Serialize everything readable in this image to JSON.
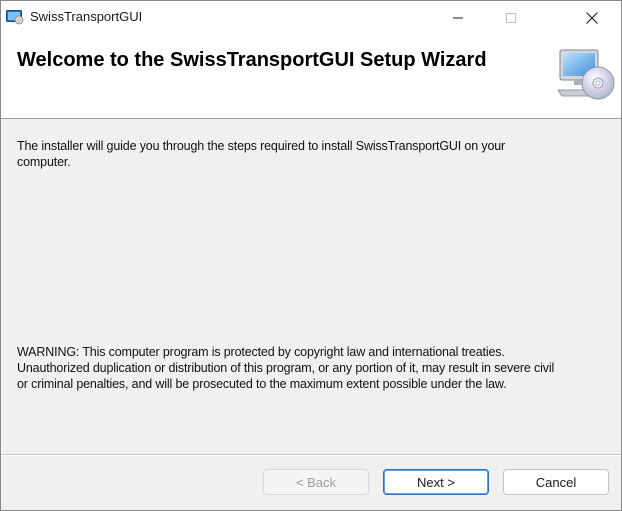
{
  "window": {
    "title": "SwissTransportGUI",
    "controls": {
      "minimize": "minimize",
      "maximize": "maximize",
      "close": "close"
    }
  },
  "header": {
    "title": "Welcome to the SwissTransportGUI Setup Wizard",
    "graphic_icon": "computer-disc-icon"
  },
  "body": {
    "intro_line1": "The installer will guide you through the steps required to install SwissTransportGUI on your",
    "intro_line2": "computer.",
    "warning_line1": "WARNING: This computer program is protected by copyright law and international treaties.",
    "warning_line2": "Unauthorized duplication or distribution of this program, or any portion of it, may result in severe civil",
    "warning_line3": "or criminal penalties, and will be prosecuted to the maximum extent possible under the law."
  },
  "buttons": {
    "back": "< Back",
    "next": "Next >",
    "cancel": "Cancel",
    "back_enabled": false
  },
  "colors": {
    "accent": "#2f6fc2",
    "disabled_text": "#9e9e9e"
  }
}
